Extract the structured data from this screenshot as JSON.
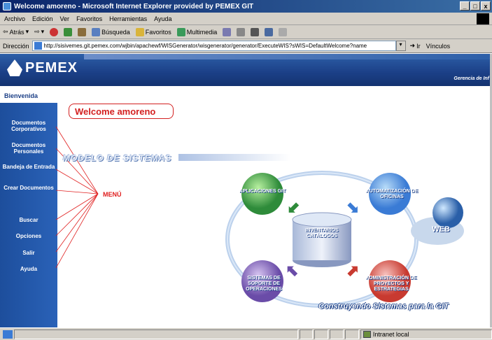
{
  "window": {
    "title": "Welcome amoreno - Microsoft Internet Explorer provided by PEMEX GIT",
    "controls": [
      "_",
      "□",
      "x"
    ]
  },
  "menubar": {
    "items": [
      "Archivo",
      "Edición",
      "Ver",
      "Favoritos",
      "Herramientas",
      "Ayuda"
    ]
  },
  "toolbar": {
    "back": "Atrás",
    "search": "Búsqueda",
    "favorites": "Favoritos",
    "multimedia": "Multimedia"
  },
  "address": {
    "label": "Dirección",
    "url": "http://sisivemes.git.pemex.com/wjbin/apachewf/WISGenerator/wisgenerator/generator/ExecuteWIS?sWIS=DefaultWelcome?name",
    "go": "Ir",
    "links": "Vínculos"
  },
  "page": {
    "brand": "PEMEX",
    "gerencia": "Gerencia de Inf",
    "active_tab": "Bienvenida",
    "welcome": "Welcome amoreno",
    "modelo": "MODELO DE SISTEMAS",
    "menu_label": "MENÚ",
    "sidebar": [
      {
        "label": "Documentos Corporativos"
      },
      {
        "label": "Documentos Personales"
      },
      {
        "label": "Bandeja de Entrada"
      },
      {
        "label": "Crear Documentos"
      },
      {
        "label": "Buscar"
      },
      {
        "label": "Opciones"
      },
      {
        "label": "Salir"
      },
      {
        "label": "Ayuda"
      }
    ],
    "diagram": {
      "center": "INVENTARIOS CATÁLOGOS",
      "top_left": "APLICACIONES GIT",
      "top_right": "AUTOMATIZACIÓN DE OFICINAS",
      "bottom_left": "SISTEMAS DE SOPORTE DE OPERACIONES",
      "bottom_right": "ADMINISTRACIÓN DE PROYECTOS Y ESTRATEGIAS",
      "web": "WEB"
    },
    "tagline": "Construyendo Sistemas para la GIT"
  },
  "statusbar": {
    "zone": "Intranet local"
  },
  "colors": {
    "brand_blue": "#1b3f86",
    "accent_red": "#d32020",
    "chrome": "#d4d0c8"
  }
}
